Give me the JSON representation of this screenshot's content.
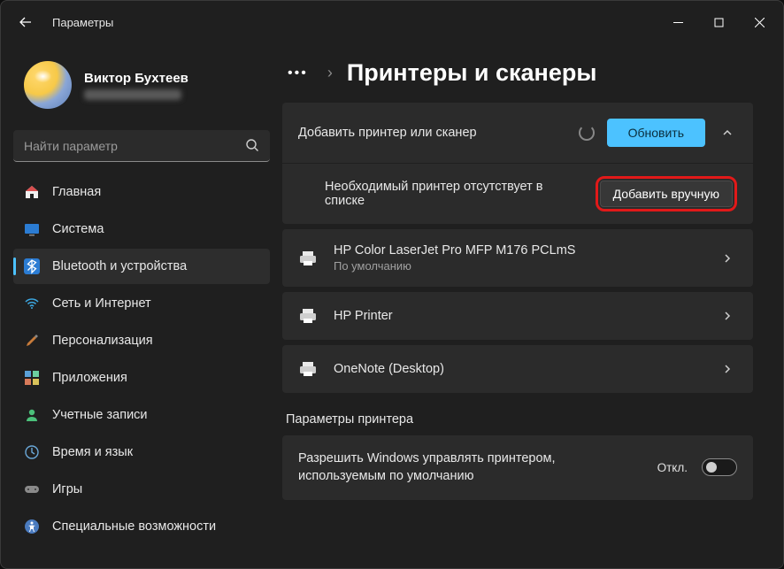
{
  "window": {
    "title": "Параметры"
  },
  "profile": {
    "username": "Виктор Бухтеев"
  },
  "search": {
    "placeholder": "Найти параметр"
  },
  "sidebar": {
    "items": [
      {
        "label": "Главная"
      },
      {
        "label": "Система"
      },
      {
        "label": "Bluetooth и устройства"
      },
      {
        "label": "Сеть и Интернет"
      },
      {
        "label": "Персонализация"
      },
      {
        "label": "Приложения"
      },
      {
        "label": "Учетные записи"
      },
      {
        "label": "Время и язык"
      },
      {
        "label": "Игры"
      },
      {
        "label": "Специальные возможности"
      }
    ]
  },
  "breadcrumb": {
    "page": "Принтеры и сканеры"
  },
  "add_panel": {
    "title": "Добавить принтер или сканер",
    "refresh_btn": "Обновить",
    "missing_text": "Необходимый принтер отсутствует в списке",
    "add_manual_btn": "Добавить вручную"
  },
  "printers": [
    {
      "name": "HP Color LaserJet Pro MFP M176 PCLmS",
      "sub": "По умолчанию"
    },
    {
      "name": "HP Printer",
      "sub": ""
    },
    {
      "name": "OneNote (Desktop)",
      "sub": ""
    }
  ],
  "settings_section": {
    "heading": "Параметры принтера",
    "default_manage": {
      "text": "Разрешить Windows управлять принтером, используемым по умолчанию",
      "state_label": "Откл.",
      "state": false
    }
  }
}
